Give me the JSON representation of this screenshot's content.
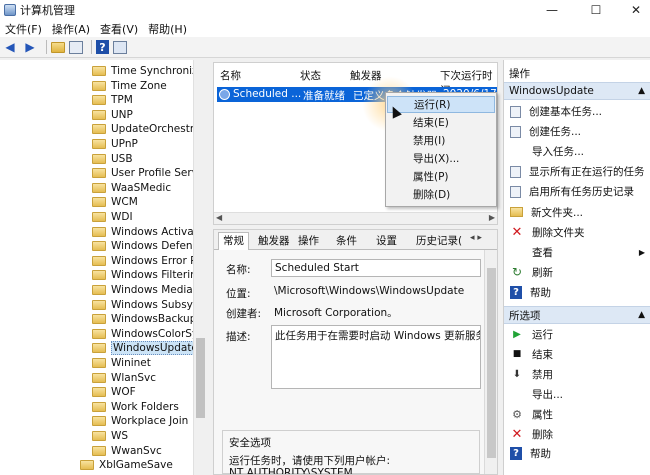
{
  "window": {
    "title": "计算机管理",
    "controls": [
      "—",
      "☐",
      "✕"
    ]
  },
  "menu": [
    "文件(F)",
    "操作(A)",
    "查看(V)",
    "帮助(H)"
  ],
  "tree": {
    "items": [
      "Time Synchronizat",
      "Time Zone",
      "TPM",
      "UNP",
      "UpdateOrchestrat",
      "UPnP",
      "USB",
      "User Profile Servic",
      "WaaSMedic",
      "WCM",
      "WDI",
      "Windows Activatio",
      "Windows Defende",
      "Windows Error Rep",
      "Windows Filtering",
      "Windows Media SI",
      "Windows Subsyste",
      "WindowsBackup",
      "WindowsColorSyst",
      "WindowsUpdate",
      "Wininet",
      "WlanSvc",
      "WOF",
      "Work Folders",
      "Workplace Join",
      "WS",
      "WwanSvc",
      "XblGameSave"
    ],
    "selected": "WindowsUpdate"
  },
  "list": {
    "columns": [
      "名称",
      "状态",
      "触发器",
      "下次运行时间"
    ],
    "row": {
      "name": "Scheduled ...",
      "status": "准备就绪",
      "trigger": "已定义多个触发器",
      "next_run": "2020/6/17 1"
    }
  },
  "context_menu": {
    "items": [
      "运行(R)",
      "结束(E)",
      "禁用(I)",
      "导出(X)...",
      "属性(P)",
      "删除(D)"
    ],
    "highlighted": "运行(R)"
  },
  "detail": {
    "tabs": [
      "常规",
      "触发器",
      "操作",
      "条件",
      "设置",
      "历史记录("
    ],
    "active_tab": "常规",
    "tab_arrows": "◂ ▸",
    "labels": {
      "name": "名称:",
      "location": "位置:",
      "author": "创建者:",
      "description": "描述:"
    },
    "values": {
      "name": "Scheduled Start",
      "location": "\\Microsoft\\Windows\\WindowsUpdate",
      "author": "Microsoft Corporation。",
      "description": "此任务用于在需要时启动 Windows 更新服务以执"
    },
    "security": {
      "title": "安全选项",
      "text": "运行任务时，请使用下列用户帐户:",
      "account": "NT AUTHORITY\\SYSTEM"
    }
  },
  "actions": {
    "header": "操作",
    "group1": {
      "title": "WindowsUpdate",
      "items": [
        {
          "label": "创建基本任务...",
          "icon": "create-basic-task-icon"
        },
        {
          "label": "创建任务...",
          "icon": "create-task-icon"
        },
        {
          "label": "导入任务...",
          "icon": "none"
        },
        {
          "label": "显示所有正在运行的任务",
          "icon": "running-tasks-icon"
        },
        {
          "label": "启用所有任务历史记录",
          "icon": "history-icon"
        },
        {
          "label": "新文件夹...",
          "icon": "new-folder-icon"
        },
        {
          "label": "删除文件夹",
          "icon": "delete-icon"
        },
        {
          "label": "查看",
          "icon": "none"
        },
        {
          "label": "刷新",
          "icon": "refresh-icon"
        },
        {
          "label": "帮助",
          "icon": "help-icon"
        }
      ]
    },
    "group2": {
      "title": "所选项",
      "items": [
        {
          "label": "运行",
          "icon": "run-icon"
        },
        {
          "label": "结束",
          "icon": "end-icon"
        },
        {
          "label": "禁用",
          "icon": "disable-icon"
        },
        {
          "label": "导出...",
          "icon": "none"
        },
        {
          "label": "属性",
          "icon": "properties-icon"
        },
        {
          "label": "删除",
          "icon": "delete-icon"
        },
        {
          "label": "帮助",
          "icon": "help-icon"
        }
      ]
    }
  }
}
